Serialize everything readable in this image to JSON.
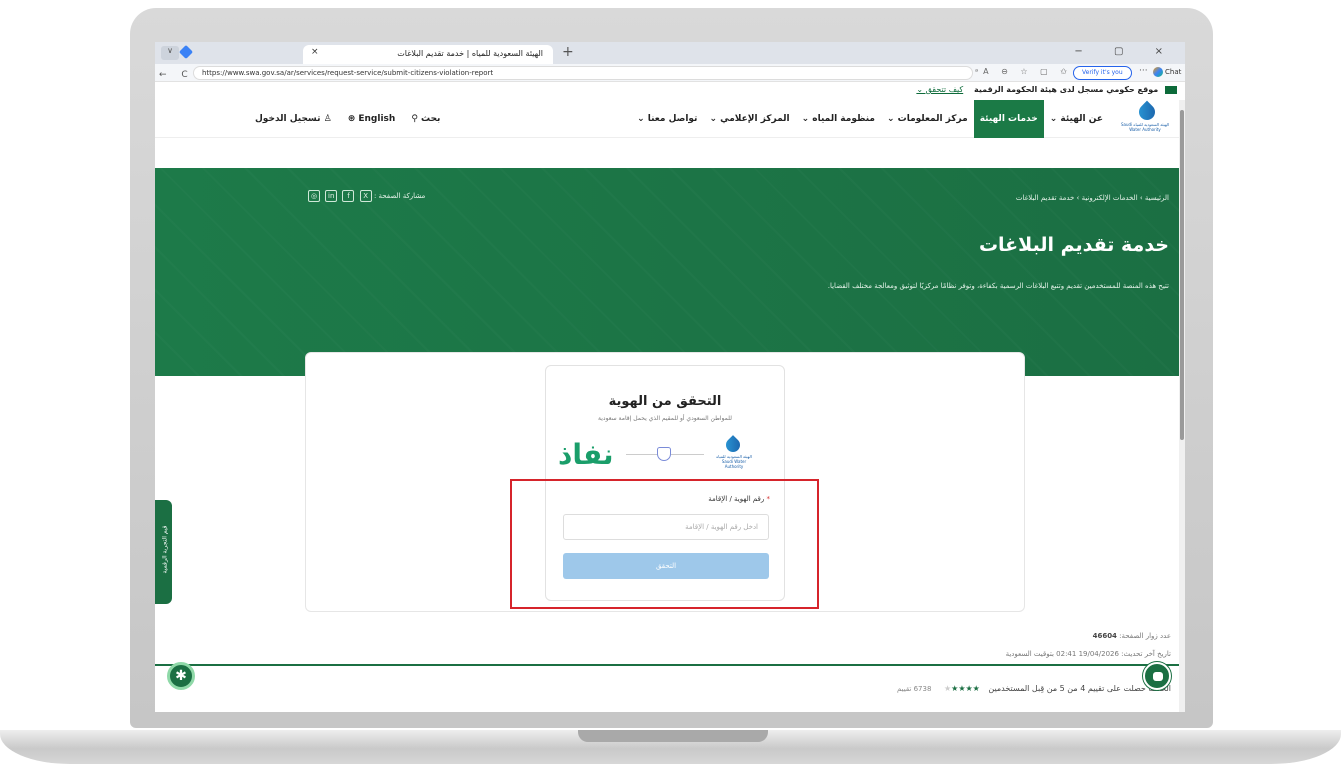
{
  "browser": {
    "tab_title": "الهيئة السعودية للمياه | خدمة تقديم البلاغات",
    "tab_close": "×",
    "new_tab": "+",
    "url": "https://www.swa.gov.sa/ar/services/request-service/submit-citizens-violation-report",
    "verify_label": "Verify it's you",
    "more": "···",
    "copilot_label": "Chat",
    "nav": "← C ⓘ",
    "tab_menu": "∨",
    "window_controls": "− ▢ ×",
    "addr_icons": "ᵃA ⊖ ☆ ▢ ✩"
  },
  "gov_strip": {
    "text": "موقع حكومي مسجل لدى هيئة الحكومة الرقمية",
    "link": "كيف تتحقق ⌄"
  },
  "site_nav": {
    "logo_text": "الهيئة السعودية للمياه Saudi Water Authority",
    "items": [
      {
        "label": "عن الهيئة ⌄",
        "active": false
      },
      {
        "label": "خدمات الهيئة",
        "active": true
      },
      {
        "label": "مركز المعلومات ⌄",
        "active": false
      },
      {
        "label": "منظومة المياه ⌄",
        "active": false
      },
      {
        "label": "المركز الإعلامي ⌄",
        "active": false
      },
      {
        "label": "تواصل معنا ⌄",
        "active": false
      }
    ],
    "search_label": "بحث",
    "search_icon": "search-icon",
    "language_label": "English",
    "login_label": "تسجيل الدخول"
  },
  "hero": {
    "breadcrumb": "الرئيسية  ›  الخدمات الإلكترونية  ›  خدمة تقديم البلاغات",
    "share_label": "مشاركة الصفحة :",
    "share_icons": [
      "X",
      "f",
      "in",
      "◎"
    ],
    "title": "خدمة تقديم البلاغات",
    "description": "تتيح هذه المنصة للمستخدمين تقديم وتتبع البلاغات الرسمية بكفاءة، وتوفر نظامًا مركزيًا لتوثيق ومعالجة مختلف القضايا."
  },
  "verify_card": {
    "title": "التحقق من الهوية",
    "subtitle": "للمواطن السعودي أو للمقيم الذي يحمل إقامة سعودية",
    "nafath": "نفاذ",
    "logo_text": "الهيئة السعودية للمياه Saudi Water Authority",
    "field_label": "رقم الهوية / الإقامة",
    "required_mark": "*",
    "field_placeholder": "ادخل رقم الهوية / الإقامة",
    "field_value": "",
    "submit_label": "التحقق"
  },
  "meta": {
    "visits_label": "عدد زوار الصفحة:",
    "visits_value": "46604",
    "updated": "تاريخ آخر تحديث: 19/04/2026 02:41 بتوقيت السعودية"
  },
  "rating": {
    "text": "الخدمة حصلت على تقييم 4 من 5 من قِبل المستخدمين",
    "stars_filled": "★★★★",
    "stars_empty": "★",
    "count": "6738 تقييم",
    "value": 4,
    "max": 5
  },
  "side_tab": {
    "label": "قيم التجربة الرقمية"
  },
  "accessibility_icon": "accessibility-icon",
  "colors": {
    "primary_green": "#1b6f43",
    "highlight_red": "#d6242b",
    "button_disabled": "#9ec8ea"
  }
}
